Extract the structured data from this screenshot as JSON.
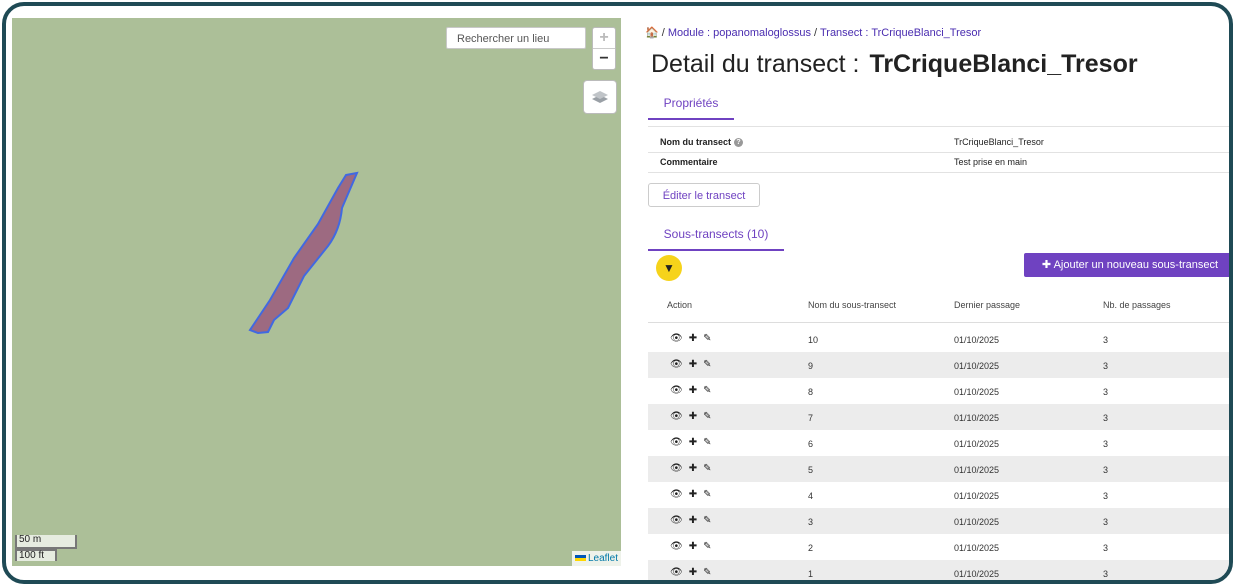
{
  "map": {
    "search_placeholder": "Rechercher un lieu",
    "zoom_in": "+",
    "zoom_out": "−",
    "scale_metric": "50 m",
    "scale_imperial": "100 ft",
    "attribution": "Leaflet",
    "colors": {
      "background": "#acbf98",
      "polygon_fill": "#9a5a7c",
      "polygon_stroke": "#4169e1"
    }
  },
  "breadcrumb": {
    "home_icon": "home-icon",
    "sep": "/",
    "module": "Module : popanomaloglossus",
    "transect": "Transect : TrCriqueBlanci_Tresor"
  },
  "header": {
    "prefix": "Detail du transect :",
    "name": "TrCriqueBlanci_Tresor"
  },
  "tabs": {
    "properties": "Propriétés",
    "subtransects": "Sous-transects (10)"
  },
  "properties": [
    {
      "key": "Nom du transect",
      "value": "TrCriqueBlanci_Tresor"
    },
    {
      "key": "Commentaire",
      "value": "Test prise en main"
    }
  ],
  "buttons": {
    "edit": "Éditer le transect",
    "add": "✚ Ajouter un nouveau sous-transect",
    "accent": "#6f42c1",
    "filter_color": "#f6d31a"
  },
  "table": {
    "headers": [
      "Action",
      "Nom du sous-transect",
      "Dernier passage",
      "Nb. de passages"
    ],
    "action_icons": {
      "view": "👁",
      "add": "✚",
      "edit": "✎"
    },
    "rows": [
      {
        "name": "10",
        "date": "01/10/2025",
        "count": "3"
      },
      {
        "name": "9",
        "date": "01/10/2025",
        "count": "3"
      },
      {
        "name": "8",
        "date": "01/10/2025",
        "count": "3"
      },
      {
        "name": "7",
        "date": "01/10/2025",
        "count": "3"
      },
      {
        "name": "6",
        "date": "01/10/2025",
        "count": "3"
      },
      {
        "name": "5",
        "date": "01/10/2025",
        "count": "3"
      },
      {
        "name": "4",
        "date": "01/10/2025",
        "count": "3"
      },
      {
        "name": "3",
        "date": "01/10/2025",
        "count": "3"
      },
      {
        "name": "2",
        "date": "01/10/2025",
        "count": "3"
      },
      {
        "name": "1",
        "date": "01/10/2025",
        "count": "3"
      }
    ]
  }
}
